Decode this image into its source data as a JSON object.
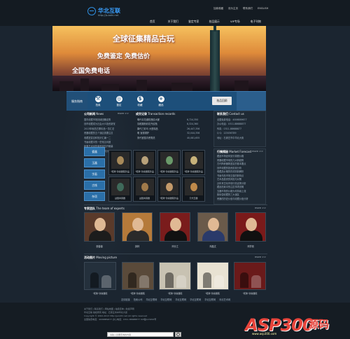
{
  "site": {
    "logo_text": "华北互联",
    "logo_url": "http://js.bdhl.net"
  },
  "toplinks": [
    "加我收藏",
    "设为主页",
    "联系我们",
    "ENGLISH"
  ],
  "nav": [
    "首页",
    "关于我们",
    "鉴定专家",
    "拍品展示",
    "VIP专场",
    "电子刊物"
  ],
  "banner": {
    "title": "全球征集精品古玩",
    "line2": "免费鉴定 免费估价",
    "line3": "全国免费电话"
  },
  "services": {
    "label": "服务指南",
    "items": [
      {
        "icon": "hammer-icon",
        "glyph": "⚒",
        "label": "拍卖"
      },
      {
        "icon": "compass-icon",
        "glyph": "◎",
        "label": "鉴定"
      },
      {
        "icon": "dollar-icon",
        "glyph": "$",
        "label": "收藏"
      },
      {
        "icon": "zoom-icon",
        "glyph": "+",
        "label": "藏品"
      }
    ],
    "cta": "拍品回顾"
  },
  "news": {
    "title": "公司新闻",
    "title_en": "News",
    "more": "more >>",
    "items": [
      "国内收藏市场持续回暖走势",
      "钱币收藏成为社会大众投资新宠",
      "2013年秋拍古董珍品一览汇总",
      "瓷器收藏的五个误区需要注意",
      "收藏鉴赏百科知识汇编一二",
      "书画收藏中的一些常见问题",
      "新春艺术品拍卖即将拉开帷幕",
      "近年古代瓷器拍卖行情分析"
    ]
  },
  "records": {
    "title": "成交记录",
    "title_en": "Transaction records",
    "rows": [
      [
        "明代青花缠枝莲纹大罐",
        "6,724,350"
      ],
      [
        "清乾隆粉彩花卉纹瓶",
        "8,324,360"
      ],
      [
        "唐代三彩马 大型精品",
        "26,447,356"
      ],
      [
        "明 宣德铜炉",
        "32,044,356"
      ],
      [
        "宋代官窑青瓷笔洗",
        "40,081,655"
      ]
    ]
  },
  "contact": {
    "title": "联系我们",
    "title_en": "Contact us",
    "lines": [
      "全国免费电话：4006889677",
      "办公电话：0311-88688877",
      "传真：0311-88688877",
      "Q Q：123456789",
      "地址：石家庄市中华北大街"
    ]
  },
  "market": {
    "title": "行情揭秘",
    "title_en": "Market Forecast",
    "more": "more >>",
    "items": [
      "藏品市场如何划分真假价格",
      "瓷器收藏市场的几大新趋势",
      "古代陶瓷器物鉴定的基本要点",
      "钱币收藏的投资前景分析",
      "收藏品价格的形成机制解析",
      "书画作品市场交易的新特点",
      "艺术品投资的风险与对策",
      "近年来古玩市场行情走势分析",
      "藏品拍卖中的注意事项说明",
      "玉器市场的价格为何持续上涨",
      "紫砂壶收藏的三大误区",
      "瓷器的历史价值与收藏价值分析"
    ]
  },
  "categories": [
    "瓷器",
    "玉器",
    "字画",
    "古钱",
    "杂项"
  ],
  "goods": [
    {
      "name": "\"乾隆\"款瓷器碗珍品",
      "color": "#a88a5a"
    },
    {
      "name": "\"乾隆\"款瓷器碗珍品",
      "color": "#b9a27a"
    },
    {
      "name": "\"乾隆\"款瓷器碗珍品",
      "color": "#6a9a6a"
    },
    {
      "name": "\"乾隆\"款瓷器碗珍品",
      "color": "#c8b27a"
    },
    {
      "name": "战国青铜器",
      "color": "#3f6a5a"
    },
    {
      "name": "战国青铜器",
      "color": "#a07a4a"
    },
    {
      "name": "\"乾隆\"款瓷器碗珍品",
      "color": "#c49a6a"
    },
    {
      "name": "元代玉器",
      "color": "#c08a4a"
    }
  ],
  "experts": {
    "title": "专家团队",
    "title_en": "The team of experts",
    "more": "more >>",
    "people": [
      {
        "name": "张馨馨",
        "bg": "#5a3a2a",
        "body": "#1c1c1c"
      },
      {
        "name": "钟林",
        "bg": "#b57a3a",
        "body": "#2a2a2a"
      },
      {
        "name": "邓长江",
        "bg": "#7a1c1c",
        "body": "#111"
      },
      {
        "name": "邓晶文",
        "bg": "#6a5a4a",
        "body": "#2a3a6a"
      },
      {
        "name": "邓学则",
        "bg": "#7a1a1a",
        "body": "#101010"
      }
    ]
  },
  "activities": {
    "title": "活动图片",
    "title_en": "Moving picture",
    "more": "more >>",
    "items": [
      {
        "name": "\"乾隆\"款瓷器碗",
        "bg": "#24303c"
      },
      {
        "name": "\"乾隆\"款瓷器碗",
        "bg": "#5a4a3a"
      },
      {
        "name": "\"乾隆\"款瓷器碗",
        "bg": "#c8c2b2"
      },
      {
        "name": "\"乾隆\"款瓷器碗",
        "bg": "#e8e2d2"
      },
      {
        "name": "\"乾隆\"款瓷器碗",
        "bg": "#6a1a1a"
      }
    ]
  },
  "footer_links": [
    "友情链接",
    "拍卖公司",
    "华北互联网",
    "华北互联网",
    "华北互联网",
    "华北互联网",
    "华北互联网",
    "河北艺术网"
  ],
  "footer": {
    "lines": [
      "关于我们 | 联系我们 | 网站地图 | 拍卖咨询 | 免责声明",
      "华北互联 版权所有 地址：石家庄市中华北大街",
      "Copyright © 2002-2013 http://js.bdhl.net All rights reserved",
      "全国免费电话：4006889677 办公电话：0311-88688877 ICP备123456号"
    ],
    "search_placeholder": "请输入您要查询的内容"
  },
  "watermark": {
    "brand": "ASP300",
    "cn": "源码",
    "url": "www.asp300.com"
  }
}
